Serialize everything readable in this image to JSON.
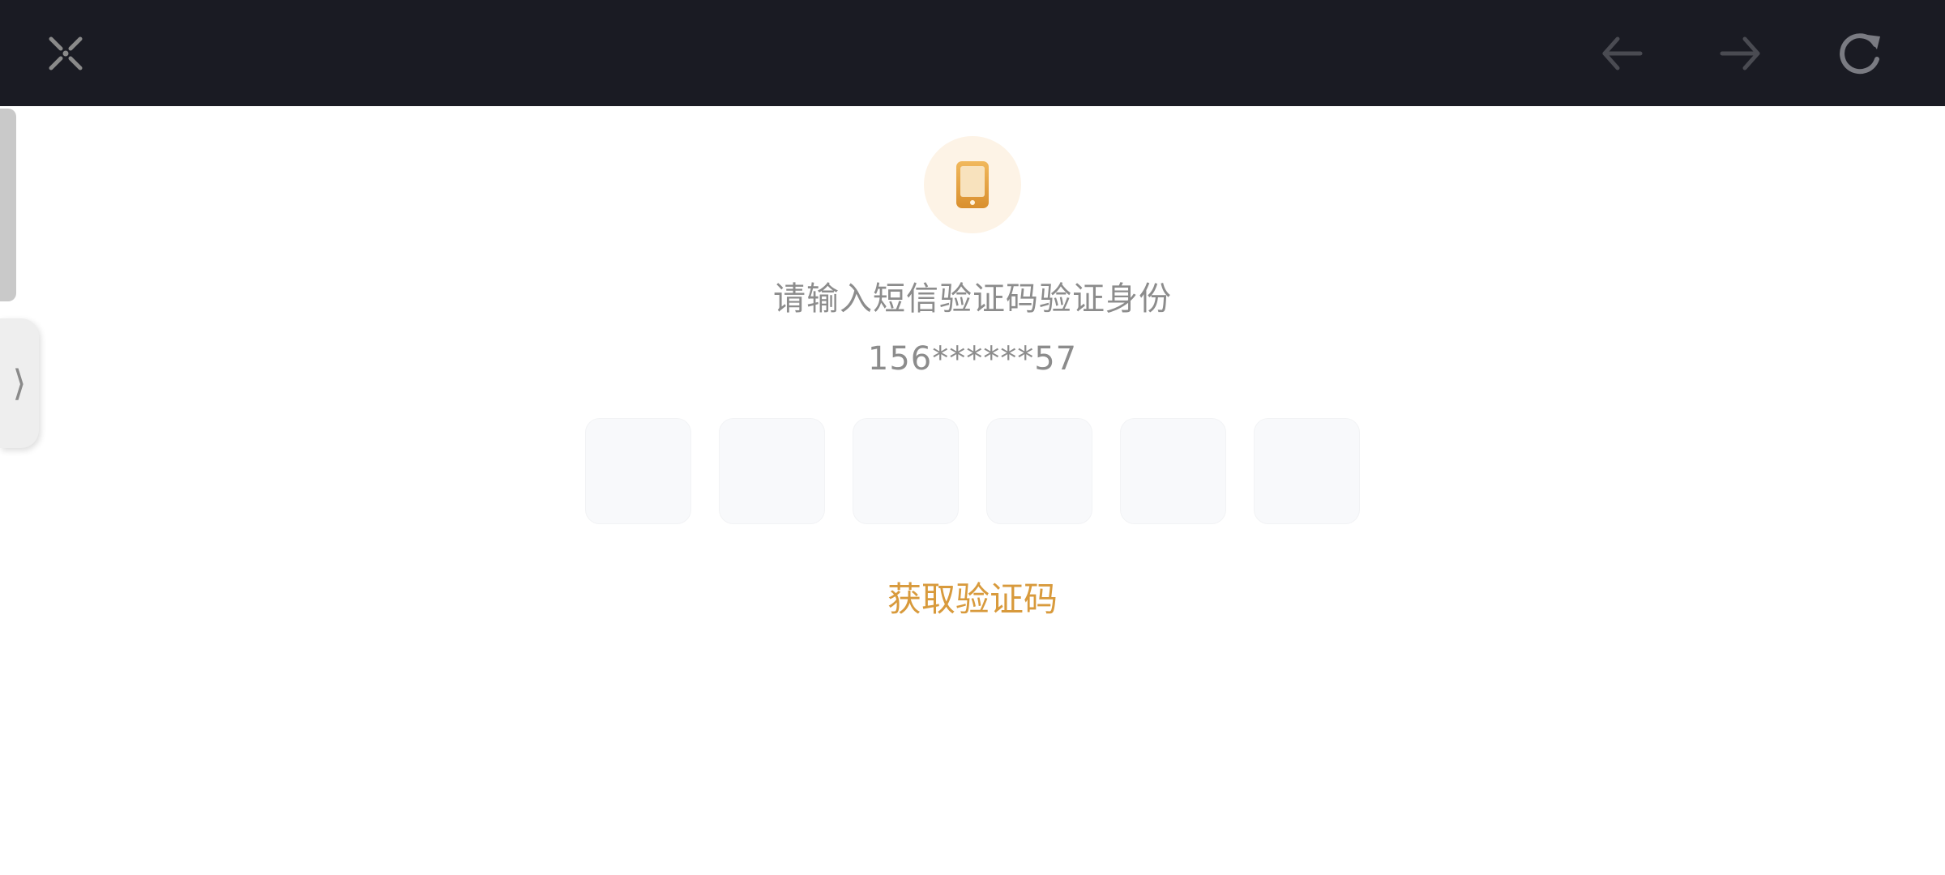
{
  "toolbar": {
    "close_icon": "close-icon",
    "back_icon": "arrow-left-icon",
    "forward_icon": "arrow-right-icon",
    "reload_icon": "reload-icon"
  },
  "side_panel": {
    "expand_glyph": "⟩"
  },
  "verify": {
    "icon": "phone-icon",
    "title": "请输入短信验证码验证身份",
    "phone_masked": "156******57",
    "code_digits": [
      "",
      "",
      "",
      "",
      "",
      ""
    ],
    "get_code_label": "获取验证码"
  },
  "colors": {
    "topbar_bg": "#1a1b23",
    "accent": "#d89a3c",
    "icon_circle_bg": "#fdf3e6",
    "text_gray": "#8c8c8c"
  }
}
